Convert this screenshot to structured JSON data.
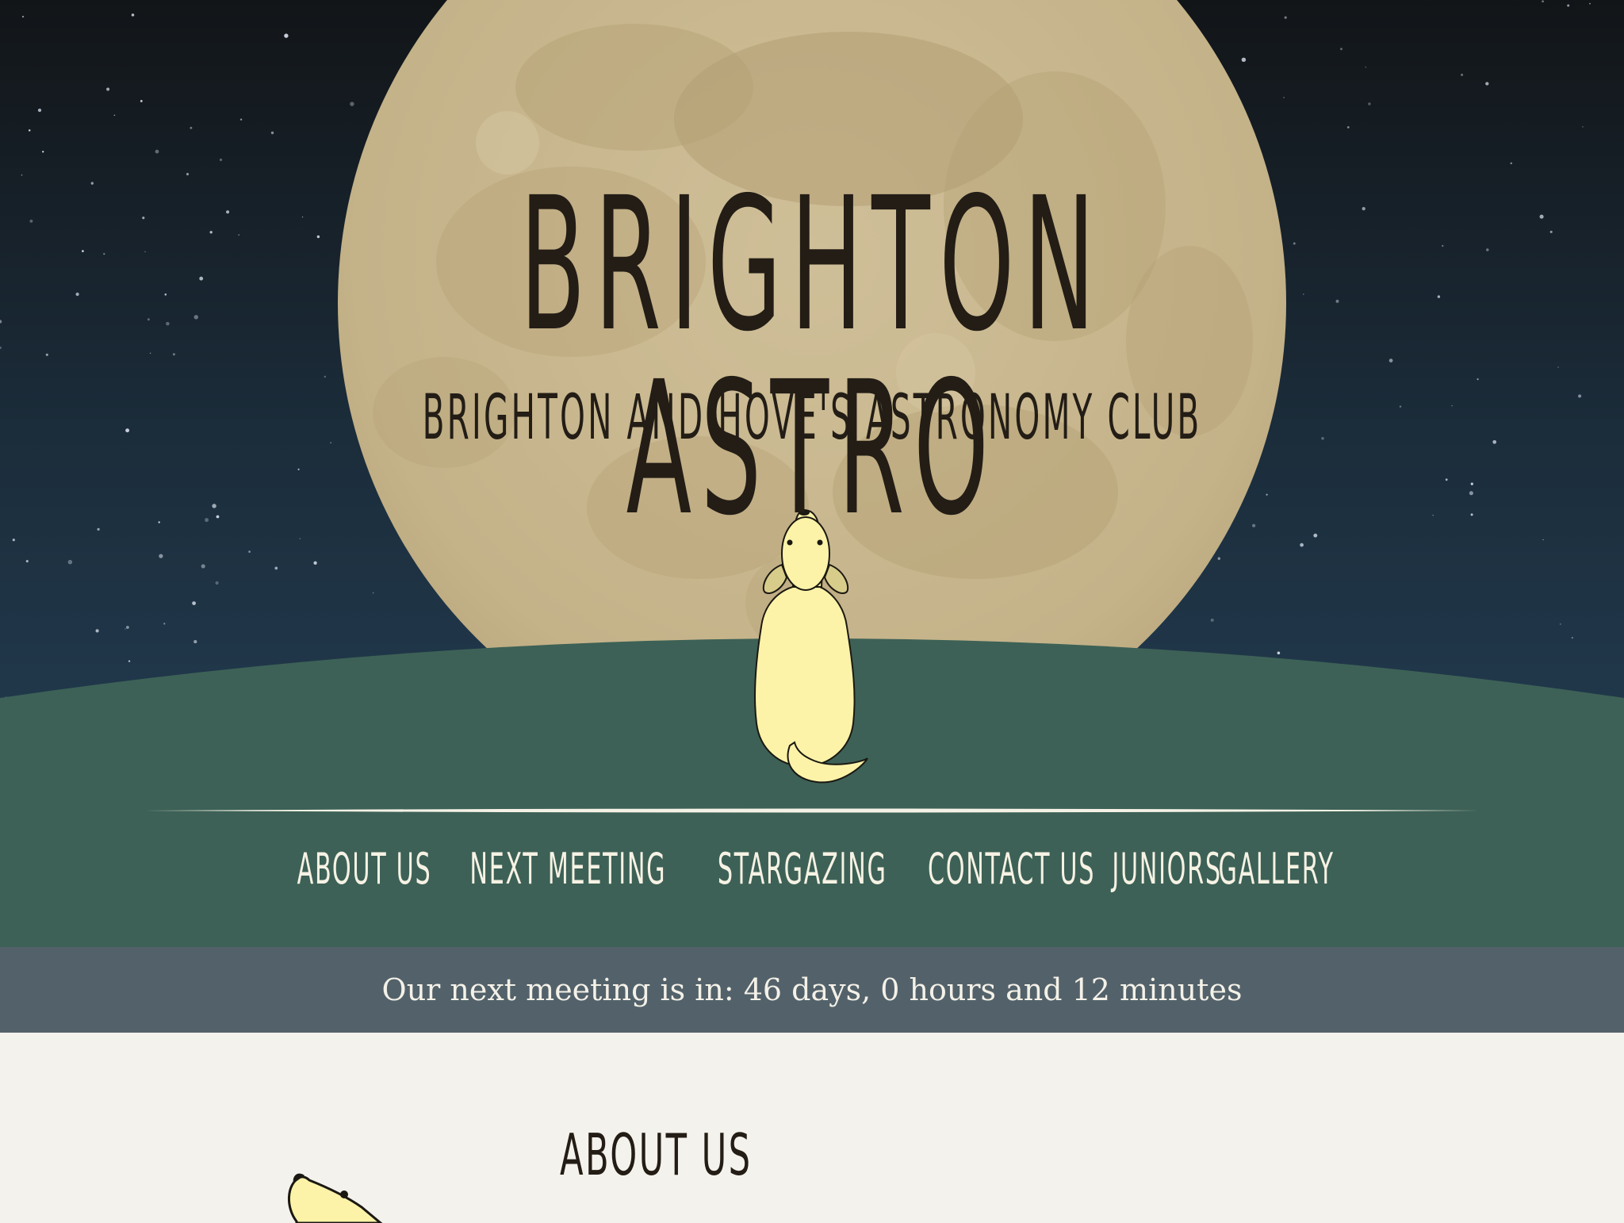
{
  "header": {
    "title": "BRIGHTON ASTRO",
    "subtitle": "BRIGHTON AND HOVE'S ASTRONOMY CLUB"
  },
  "nav": {
    "items": [
      {
        "label": "ABOUT US"
      },
      {
        "label": "NEXT MEETING"
      },
      {
        "label": "STARGAZING"
      },
      {
        "label": "CONTACT US"
      },
      {
        "label": "JUNIORS"
      },
      {
        "label": "GALLERY"
      }
    ]
  },
  "countdown": {
    "text": "Our next meeting is in: 46 days, 0 hours and 12 minutes"
  },
  "about": {
    "heading": "ABOUT US"
  },
  "colors": {
    "sky_top": "#121518",
    "sky_bottom": "#25425a",
    "moon": "#c7b68e",
    "hill": "#3d6156",
    "dog": "#fcf3a8",
    "countdown_bar": "#53626a",
    "page_background": "#f4f2ec",
    "text_dark": "#231d16",
    "nav_text": "#f6f2e4"
  },
  "icons": {
    "hero_illustration": "dog-looking-at-moon",
    "section_icon": "dog-head-icon"
  }
}
